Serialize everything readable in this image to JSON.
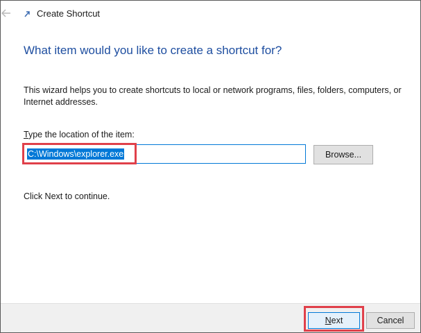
{
  "window": {
    "title": "Create Shortcut",
    "back_icon": "back-arrow-icon",
    "app_icon": "shortcut-icon"
  },
  "wizard": {
    "heading": "What item would you like to create a shortcut for?",
    "description": "This wizard helps you to create shortcuts to local or network programs, files, folders, computers, or Internet addresses.",
    "location_label_accel": "T",
    "location_label_rest": "ype the location of the item:",
    "location_value": "C:\\Windows\\explorer.exe",
    "browse_label": "Browse...",
    "continue_text": "Click Next to continue."
  },
  "footer": {
    "next_accel": "N",
    "next_rest": "ext",
    "cancel_label": "Cancel"
  },
  "colors": {
    "heading": "#1e4ea0",
    "selection": "#0078d7",
    "highlight": "#e0404a",
    "footer_bg": "#f0f0f0"
  }
}
